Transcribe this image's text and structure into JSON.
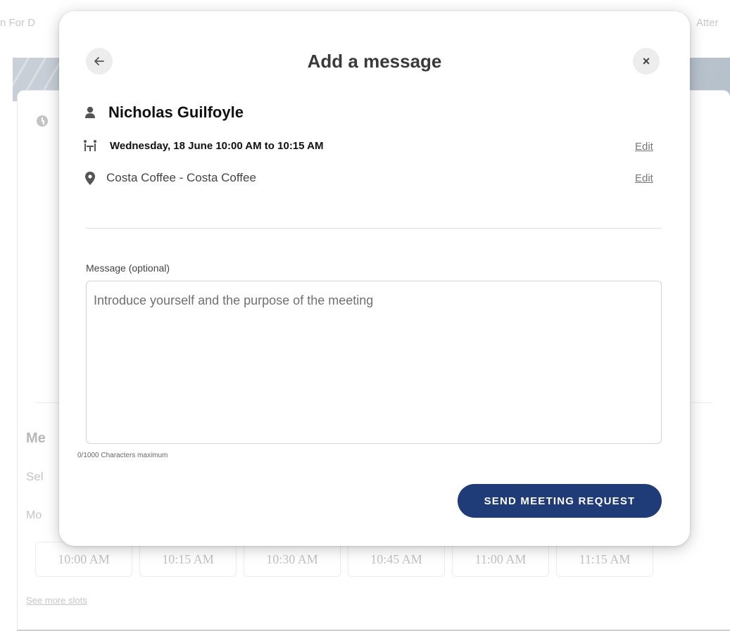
{
  "background": {
    "top_left_text": "n For D",
    "top_right_text": "Atter",
    "section_heading": "Me",
    "section_subtitle": "Sel",
    "day_label": "Mo",
    "time_slots": [
      "10:00 AM",
      "10:15 AM",
      "10:30 AM",
      "10:45 AM",
      "11:00 AM",
      "11:15 AM"
    ],
    "see_more_link": "See more slots"
  },
  "modal": {
    "title": "Add a message",
    "back_icon": "arrow-left-icon",
    "close_icon": "close-icon",
    "close_symbol": "×",
    "attendee": {
      "icon": "person-icon",
      "name": "Nicholas Guilfoyle"
    },
    "time": {
      "icon": "meeting-table-icon",
      "text": "Wednesday, 18 June 10:00 AM to 10:15 AM",
      "edit_label": "Edit"
    },
    "location": {
      "icon": "map-pin-icon",
      "text": "Costa Coffee - Costa Coffee",
      "edit_label": "Edit"
    },
    "message": {
      "label": "Message (optional)",
      "placeholder": "Introduce yourself and the purpose of the meeting",
      "value": "",
      "char_count": "0/1000 Characters maximum"
    },
    "send_button": "SEND MEETING REQUEST"
  },
  "colors": {
    "primary_button": "#203c78",
    "banner": "#c2cad3",
    "modal_background": "#ffffff"
  }
}
